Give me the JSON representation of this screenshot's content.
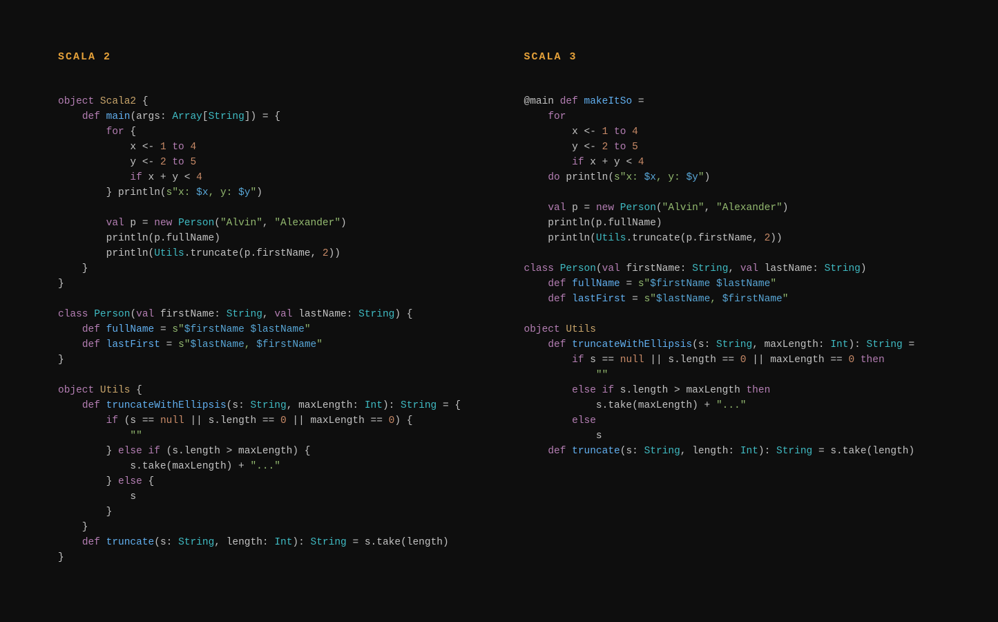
{
  "left": {
    "title": "SCALA 2",
    "code": [
      [
        [
          "kw",
          "object"
        ],
        [
          "pn",
          " "
        ],
        [
          "id",
          "Scala2"
        ],
        [
          "pn",
          " {"
        ]
      ],
      [
        [
          "pn",
          "    "
        ],
        [
          "kw",
          "def"
        ],
        [
          "pn",
          " "
        ],
        [
          "fn",
          "main"
        ],
        [
          "pn",
          "("
        ],
        [
          "par",
          "args"
        ],
        [
          "pn",
          ": "
        ],
        [
          "ty",
          "Array"
        ],
        [
          "pn",
          "["
        ],
        [
          "ty",
          "String"
        ],
        [
          "pn",
          "]) = {"
        ]
      ],
      [
        [
          "pn",
          "        "
        ],
        [
          "kw",
          "for"
        ],
        [
          "pn",
          " {"
        ]
      ],
      [
        [
          "pn",
          "            x <- "
        ],
        [
          "num",
          "1"
        ],
        [
          "pn",
          " "
        ],
        [
          "kw",
          "to"
        ],
        [
          "pn",
          " "
        ],
        [
          "num",
          "4"
        ]
      ],
      [
        [
          "pn",
          "            y <- "
        ],
        [
          "num",
          "2"
        ],
        [
          "pn",
          " "
        ],
        [
          "kw",
          "to"
        ],
        [
          "pn",
          " "
        ],
        [
          "num",
          "5"
        ]
      ],
      [
        [
          "pn",
          "            "
        ],
        [
          "kw",
          "if"
        ],
        [
          "pn",
          " x + y < "
        ],
        [
          "num",
          "4"
        ]
      ],
      [
        [
          "pn",
          "        } println("
        ],
        [
          "str",
          "s\"x: "
        ],
        [
          "int",
          "$x"
        ],
        [
          "str",
          ", y: "
        ],
        [
          "int",
          "$y"
        ],
        [
          "str",
          "\""
        ],
        [
          "pn",
          ")"
        ]
      ],
      [
        [
          "pn",
          ""
        ]
      ],
      [
        [
          "pn",
          "        "
        ],
        [
          "kw",
          "val"
        ],
        [
          "pn",
          " p = "
        ],
        [
          "kw",
          "new"
        ],
        [
          "pn",
          " "
        ],
        [
          "ty",
          "Person"
        ],
        [
          "pn",
          "("
        ],
        [
          "str",
          "\"Alvin\""
        ],
        [
          "pn",
          ", "
        ],
        [
          "str",
          "\"Alexander\""
        ],
        [
          "pn",
          ")"
        ]
      ],
      [
        [
          "pn",
          "        println(p.fullName)"
        ]
      ],
      [
        [
          "pn",
          "        println("
        ],
        [
          "ty",
          "Utils"
        ],
        [
          "pn",
          ".truncate(p.firstName, "
        ],
        [
          "num",
          "2"
        ],
        [
          "pn",
          "))"
        ]
      ],
      [
        [
          "pn",
          "    }"
        ]
      ],
      [
        [
          "pn",
          "}"
        ]
      ],
      [
        [
          "pn",
          ""
        ]
      ],
      [
        [
          "kw",
          "class"
        ],
        [
          "pn",
          " "
        ],
        [
          "ty",
          "Person"
        ],
        [
          "pn",
          "("
        ],
        [
          "kw",
          "val"
        ],
        [
          "pn",
          " "
        ],
        [
          "par",
          "firstName"
        ],
        [
          "pn",
          ": "
        ],
        [
          "ty",
          "String"
        ],
        [
          "pn",
          ", "
        ],
        [
          "kw",
          "val"
        ],
        [
          "pn",
          " "
        ],
        [
          "par",
          "lastName"
        ],
        [
          "pn",
          ": "
        ],
        [
          "ty",
          "String"
        ],
        [
          "pn",
          ") {"
        ]
      ],
      [
        [
          "pn",
          "    "
        ],
        [
          "kw",
          "def"
        ],
        [
          "pn",
          " "
        ],
        [
          "fn",
          "fullName"
        ],
        [
          "pn",
          " = "
        ],
        [
          "str",
          "s\""
        ],
        [
          "int",
          "$firstName"
        ],
        [
          "str",
          " "
        ],
        [
          "int",
          "$lastName"
        ],
        [
          "str",
          "\""
        ]
      ],
      [
        [
          "pn",
          "    "
        ],
        [
          "kw",
          "def"
        ],
        [
          "pn",
          " "
        ],
        [
          "fn",
          "lastFirst"
        ],
        [
          "pn",
          " = "
        ],
        [
          "str",
          "s\""
        ],
        [
          "int",
          "$lastName"
        ],
        [
          "str",
          ", "
        ],
        [
          "int",
          "$firstName"
        ],
        [
          "str",
          "\""
        ]
      ],
      [
        [
          "pn",
          "}"
        ]
      ],
      [
        [
          "pn",
          ""
        ]
      ],
      [
        [
          "kw",
          "object"
        ],
        [
          "pn",
          " "
        ],
        [
          "id",
          "Utils"
        ],
        [
          "pn",
          " {"
        ]
      ],
      [
        [
          "pn",
          "    "
        ],
        [
          "kw",
          "def"
        ],
        [
          "pn",
          " "
        ],
        [
          "fn",
          "truncateWithEllipsis"
        ],
        [
          "pn",
          "("
        ],
        [
          "par",
          "s"
        ],
        [
          "pn",
          ": "
        ],
        [
          "ty",
          "String"
        ],
        [
          "pn",
          ", "
        ],
        [
          "par",
          "maxLength"
        ],
        [
          "pn",
          ": "
        ],
        [
          "ty",
          "Int"
        ],
        [
          "pn",
          "): "
        ],
        [
          "ty",
          "String"
        ],
        [
          "pn",
          " = {"
        ]
      ],
      [
        [
          "pn",
          "        "
        ],
        [
          "kw",
          "if"
        ],
        [
          "pn",
          " (s == "
        ],
        [
          "null",
          "null"
        ],
        [
          "pn",
          " || s.length == "
        ],
        [
          "num",
          "0"
        ],
        [
          "pn",
          " || maxLength == "
        ],
        [
          "num",
          "0"
        ],
        [
          "pn",
          ") {"
        ]
      ],
      [
        [
          "pn",
          "            "
        ],
        [
          "str",
          "\"\""
        ]
      ],
      [
        [
          "pn",
          "        } "
        ],
        [
          "kw",
          "else"
        ],
        [
          "pn",
          " "
        ],
        [
          "kw",
          "if"
        ],
        [
          "pn",
          " (s.length > maxLength) {"
        ]
      ],
      [
        [
          "pn",
          "            s.take(maxLength) + "
        ],
        [
          "str",
          "\"...\""
        ]
      ],
      [
        [
          "pn",
          "        } "
        ],
        [
          "kw",
          "else"
        ],
        [
          "pn",
          " {"
        ]
      ],
      [
        [
          "pn",
          "            s"
        ]
      ],
      [
        [
          "pn",
          "        }"
        ]
      ],
      [
        [
          "pn",
          "    }"
        ]
      ],
      [
        [
          "pn",
          "    "
        ],
        [
          "kw",
          "def"
        ],
        [
          "pn",
          " "
        ],
        [
          "fn",
          "truncate"
        ],
        [
          "pn",
          "("
        ],
        [
          "par",
          "s"
        ],
        [
          "pn",
          ": "
        ],
        [
          "ty",
          "String"
        ],
        [
          "pn",
          ", "
        ],
        [
          "par",
          "length"
        ],
        [
          "pn",
          ": "
        ],
        [
          "ty",
          "Int"
        ],
        [
          "pn",
          "): "
        ],
        [
          "ty",
          "String"
        ],
        [
          "pn",
          " = s.take(length)"
        ]
      ],
      [
        [
          "pn",
          "}"
        ]
      ]
    ]
  },
  "right": {
    "title": "SCALA 3",
    "code": [
      [
        [
          "pn",
          "@main "
        ],
        [
          "kw",
          "def"
        ],
        [
          "pn",
          " "
        ],
        [
          "fn",
          "makeItSo"
        ],
        [
          "pn",
          " ="
        ]
      ],
      [
        [
          "pn",
          "    "
        ],
        [
          "kw",
          "for"
        ]
      ],
      [
        [
          "pn",
          "        x <- "
        ],
        [
          "num",
          "1"
        ],
        [
          "pn",
          " "
        ],
        [
          "kw",
          "to"
        ],
        [
          "pn",
          " "
        ],
        [
          "num",
          "4"
        ]
      ],
      [
        [
          "pn",
          "        y <- "
        ],
        [
          "num",
          "2"
        ],
        [
          "pn",
          " "
        ],
        [
          "kw",
          "to"
        ],
        [
          "pn",
          " "
        ],
        [
          "num",
          "5"
        ]
      ],
      [
        [
          "pn",
          "        "
        ],
        [
          "kw",
          "if"
        ],
        [
          "pn",
          " x + y < "
        ],
        [
          "num",
          "4"
        ]
      ],
      [
        [
          "pn",
          "    "
        ],
        [
          "kw",
          "do"
        ],
        [
          "pn",
          " println("
        ],
        [
          "str",
          "s\"x: "
        ],
        [
          "int",
          "$x"
        ],
        [
          "str",
          ", y: "
        ],
        [
          "int",
          "$y"
        ],
        [
          "str",
          "\""
        ],
        [
          "pn",
          ")"
        ]
      ],
      [
        [
          "pn",
          ""
        ]
      ],
      [
        [
          "pn",
          "    "
        ],
        [
          "kw",
          "val"
        ],
        [
          "pn",
          " p = "
        ],
        [
          "kw",
          "new"
        ],
        [
          "pn",
          " "
        ],
        [
          "ty",
          "Person"
        ],
        [
          "pn",
          "("
        ],
        [
          "str",
          "\"Alvin\""
        ],
        [
          "pn",
          ", "
        ],
        [
          "str",
          "\"Alexander\""
        ],
        [
          "pn",
          ")"
        ]
      ],
      [
        [
          "pn",
          "    println(p.fullName)"
        ]
      ],
      [
        [
          "pn",
          "    println("
        ],
        [
          "ty",
          "Utils"
        ],
        [
          "pn",
          ".truncate(p.firstName, "
        ],
        [
          "num",
          "2"
        ],
        [
          "pn",
          "))"
        ]
      ],
      [
        [
          "pn",
          ""
        ]
      ],
      [
        [
          "kw",
          "class"
        ],
        [
          "pn",
          " "
        ],
        [
          "ty",
          "Person"
        ],
        [
          "pn",
          "("
        ],
        [
          "kw",
          "val"
        ],
        [
          "pn",
          " "
        ],
        [
          "par",
          "firstName"
        ],
        [
          "pn",
          ": "
        ],
        [
          "ty",
          "String"
        ],
        [
          "pn",
          ", "
        ],
        [
          "kw",
          "val"
        ],
        [
          "pn",
          " "
        ],
        [
          "par",
          "lastName"
        ],
        [
          "pn",
          ": "
        ],
        [
          "ty",
          "String"
        ],
        [
          "pn",
          ")"
        ]
      ],
      [
        [
          "pn",
          "    "
        ],
        [
          "kw",
          "def"
        ],
        [
          "pn",
          " "
        ],
        [
          "fn",
          "fullName"
        ],
        [
          "pn",
          " = "
        ],
        [
          "str",
          "s\""
        ],
        [
          "int",
          "$firstName"
        ],
        [
          "str",
          " "
        ],
        [
          "int",
          "$lastName"
        ],
        [
          "str",
          "\""
        ]
      ],
      [
        [
          "pn",
          "    "
        ],
        [
          "kw",
          "def"
        ],
        [
          "pn",
          " "
        ],
        [
          "fn",
          "lastFirst"
        ],
        [
          "pn",
          " = "
        ],
        [
          "str",
          "s\""
        ],
        [
          "int",
          "$lastName"
        ],
        [
          "str",
          ", "
        ],
        [
          "int",
          "$firstName"
        ],
        [
          "str",
          "\""
        ]
      ],
      [
        [
          "pn",
          ""
        ]
      ],
      [
        [
          "kw",
          "object"
        ],
        [
          "pn",
          " "
        ],
        [
          "id",
          "Utils"
        ]
      ],
      [
        [
          "pn",
          "    "
        ],
        [
          "kw",
          "def"
        ],
        [
          "pn",
          " "
        ],
        [
          "fn",
          "truncateWithEllipsis"
        ],
        [
          "pn",
          "("
        ],
        [
          "par",
          "s"
        ],
        [
          "pn",
          ": "
        ],
        [
          "ty",
          "String"
        ],
        [
          "pn",
          ", "
        ],
        [
          "par",
          "maxLength"
        ],
        [
          "pn",
          ": "
        ],
        [
          "ty",
          "Int"
        ],
        [
          "pn",
          "): "
        ],
        [
          "ty",
          "String"
        ],
        [
          "pn",
          " ="
        ]
      ],
      [
        [
          "pn",
          "        "
        ],
        [
          "kw",
          "if"
        ],
        [
          "pn",
          " s == "
        ],
        [
          "null",
          "null"
        ],
        [
          "pn",
          " || s.length == "
        ],
        [
          "num",
          "0"
        ],
        [
          "pn",
          " || maxLength == "
        ],
        [
          "num",
          "0"
        ],
        [
          "pn",
          " "
        ],
        [
          "kw",
          "then"
        ]
      ],
      [
        [
          "pn",
          "            "
        ],
        [
          "str",
          "\"\""
        ]
      ],
      [
        [
          "pn",
          "        "
        ],
        [
          "kw",
          "else"
        ],
        [
          "pn",
          " "
        ],
        [
          "kw",
          "if"
        ],
        [
          "pn",
          " s.length > maxLength "
        ],
        [
          "kw",
          "then"
        ]
      ],
      [
        [
          "pn",
          "            s.take(maxLength) + "
        ],
        [
          "str",
          "\"...\""
        ]
      ],
      [
        [
          "pn",
          "        "
        ],
        [
          "kw",
          "else"
        ]
      ],
      [
        [
          "pn",
          "            s"
        ]
      ],
      [
        [
          "pn",
          "    "
        ],
        [
          "kw",
          "def"
        ],
        [
          "pn",
          " "
        ],
        [
          "fn",
          "truncate"
        ],
        [
          "pn",
          "("
        ],
        [
          "par",
          "s"
        ],
        [
          "pn",
          ": "
        ],
        [
          "ty",
          "String"
        ],
        [
          "pn",
          ", "
        ],
        [
          "par",
          "length"
        ],
        [
          "pn",
          ": "
        ],
        [
          "ty",
          "Int"
        ],
        [
          "pn",
          "): "
        ],
        [
          "ty",
          "String"
        ],
        [
          "pn",
          " = s.take(length)"
        ]
      ]
    ]
  }
}
